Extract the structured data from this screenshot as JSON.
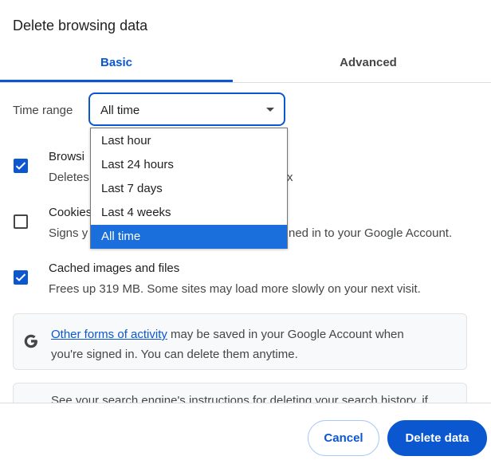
{
  "dialog": {
    "title": "Delete browsing data"
  },
  "tabs": [
    {
      "label": "Basic",
      "active": true
    },
    {
      "label": "Advanced",
      "active": false
    }
  ],
  "time_range": {
    "label": "Time range",
    "selected": "All time",
    "options": [
      "Last hour",
      "Last 24 hours",
      "Last 7 days",
      "Last 4 weeks",
      "All time"
    ]
  },
  "options": {
    "history": {
      "title": "Browsing history",
      "title_visible": "Browsi",
      "desc_visible": "Deletes",
      "desc_tail": "x",
      "checked": true
    },
    "cookies": {
      "title_visible": "Cookies",
      "desc_visible": "Signs y",
      "desc_tail": "ned in to your Google Account.",
      "checked": false
    },
    "cache": {
      "title": "Cached images and files",
      "desc": "Frees up 319 MB. Some sites may load more slowly on your next visit.",
      "checked": true
    }
  },
  "info": {
    "link": "Other forms of activity",
    "text_line1_rest": "may be saved in your Google Account when",
    "text_line2": "you're signed in. You can delete them anytime.",
    "search_note": "See your search engine's instructions for deleting your search history, if"
  },
  "footer": {
    "cancel_label": "Cancel",
    "delete_label": "Delete data"
  },
  "colors": {
    "accent": "#0b57d0",
    "selection": "#1a6fdc",
    "text": "#1f1f1f",
    "secondary_text": "#444746"
  },
  "icons": {
    "google": "google-g-icon",
    "checkmark": "checkmark-icon",
    "caret": "caret-down-icon"
  }
}
